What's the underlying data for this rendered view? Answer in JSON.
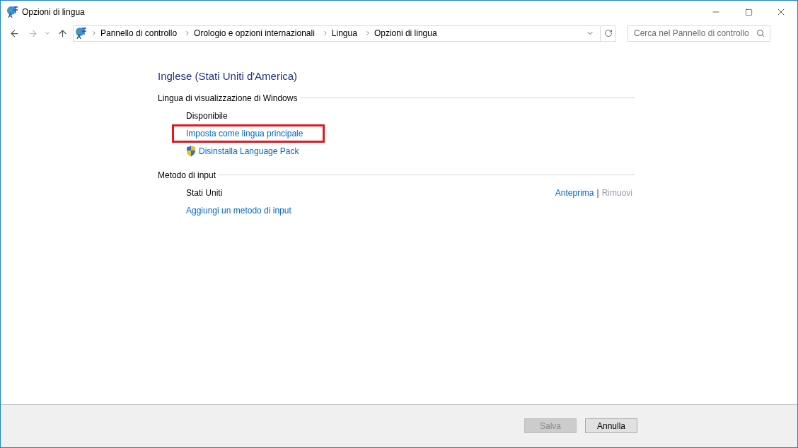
{
  "window": {
    "title": "Opzioni di lingua"
  },
  "address_bar": {
    "breadcrumbs": [
      "Pannello di controllo",
      "Orologio e opzioni internazionali",
      "Lingua",
      "Opzioni di lingua"
    ]
  },
  "search": {
    "placeholder": "Cerca nel Pannello di controllo"
  },
  "heading": "Inglese (Stati Uniti d'America)",
  "sections": [
    {
      "title": "Lingua di visualizzazione di Windows",
      "items": [
        {
          "kind": "text",
          "text": "Disponibile"
        },
        {
          "kind": "link",
          "text": "Imposta come lingua principale",
          "highlighted": true
        },
        {
          "kind": "shield-link",
          "text": "Disinstalla Language Pack",
          "highlighted": false
        }
      ]
    },
    {
      "title": "Metodo di input",
      "items": [
        {
          "kind": "row",
          "text": "Stati Uniti",
          "actions": [
            {
              "text": "Anteprima",
              "disabled": false
            },
            {
              "text": "Rimuovi",
              "disabled": true
            }
          ],
          "separator": "|"
        },
        {
          "kind": "link",
          "text": "Aggiungi un metodo di input",
          "highlighted": false
        }
      ]
    }
  ],
  "buttons": [
    {
      "label": "Salva",
      "disabled": true
    },
    {
      "label": "Annulla",
      "disabled": false
    }
  ]
}
